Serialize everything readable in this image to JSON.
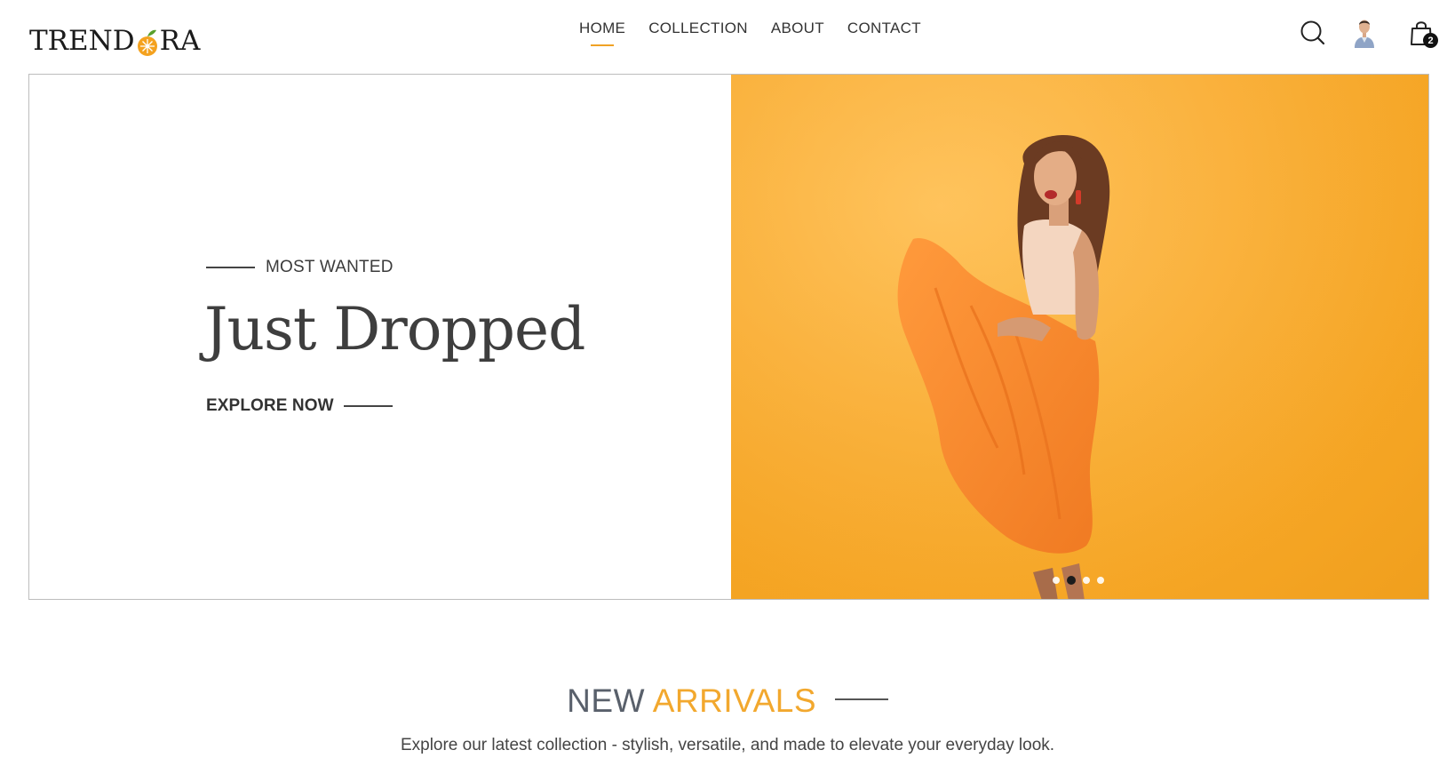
{
  "brand": {
    "logo_text_left": "TREND",
    "logo_text_right": "RA",
    "accent": "#f0a224"
  },
  "nav": [
    {
      "label": "HOME",
      "active": true
    },
    {
      "label": "COLLECTION",
      "active": false
    },
    {
      "label": "ABOUT",
      "active": false
    },
    {
      "label": "CONTACT",
      "active": false
    }
  ],
  "header_icons": {
    "search": "search-icon",
    "account": "user-avatar",
    "cart": "shopping-bag-icon",
    "cart_count": "2"
  },
  "hero": {
    "eyebrow": "MOST WANTED",
    "title": "Just Dropped",
    "cta": "EXPLORE NOW",
    "image": "woman-in-orange-dress-photo",
    "slides_count": 4,
    "active_slide": 2
  },
  "arrivals": {
    "title_part1": "NEW",
    "title_part2": "ARRIVALS",
    "subtitle": "Explore our latest collection - stylish, versatile, and made to elevate your everyday look."
  }
}
